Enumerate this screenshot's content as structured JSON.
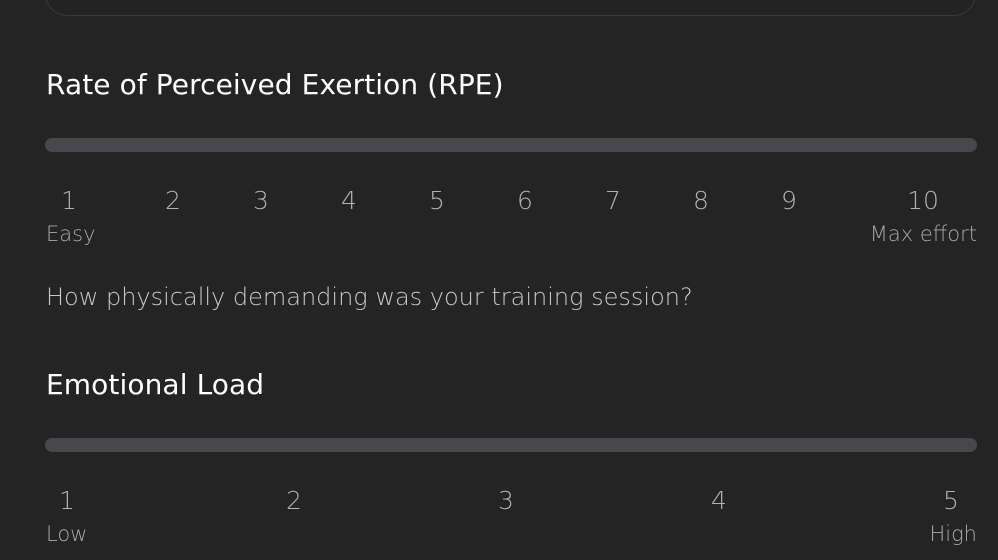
{
  "rpe": {
    "title": "Rate of Perceived Exertion (RPE)",
    "ticks": [
      "1",
      "2",
      "3",
      "4",
      "5",
      "6",
      "7",
      "8",
      "9",
      "10"
    ],
    "min_label": "Easy",
    "max_label": "Max effort",
    "question": "How physically demanding was your training session?"
  },
  "emotional": {
    "title": "Emotional Load",
    "ticks": [
      "1",
      "2",
      "3",
      "4",
      "5"
    ],
    "min_label": "Low",
    "max_label": "High"
  },
  "colors": {
    "background": "#242424",
    "track": "#48474c",
    "title": "#ffffff",
    "tick": "#b2b2b2"
  }
}
